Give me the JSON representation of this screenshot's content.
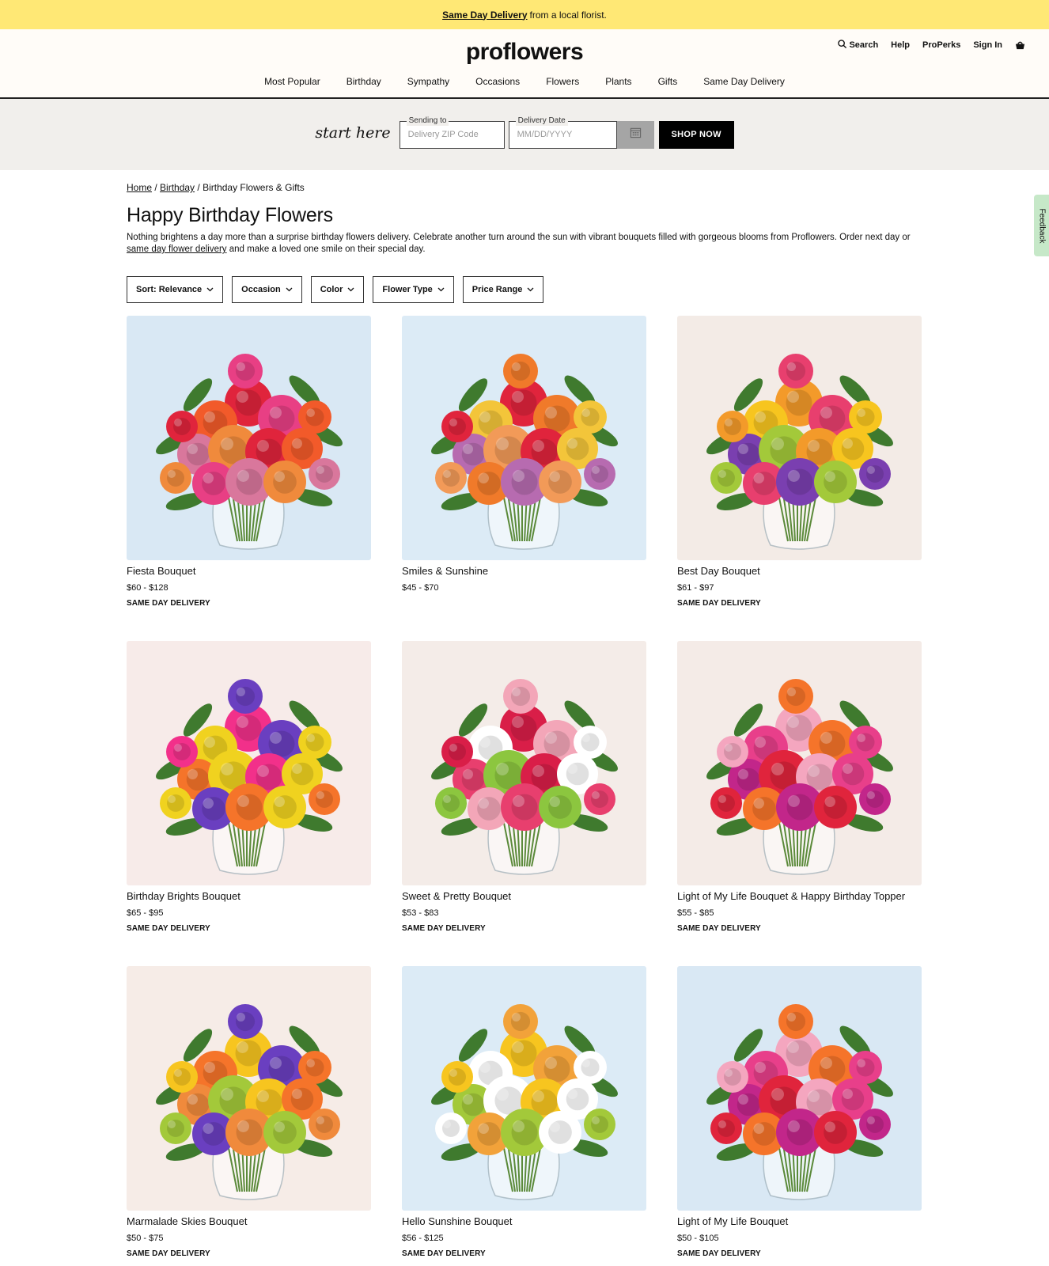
{
  "promo": {
    "link": "Same Day Delivery",
    "text": "from a local florist."
  },
  "header": {
    "logo": "proflowers",
    "utility": {
      "search": "Search",
      "help": "Help",
      "properks": "ProPerks",
      "signin": "Sign In"
    },
    "nav": [
      "Most Popular",
      "Birthday",
      "Sympathy",
      "Occasions",
      "Flowers",
      "Plants",
      "Gifts",
      "Same Day Delivery"
    ]
  },
  "start": {
    "label": "start here",
    "zip_legend": "Sending to",
    "zip_placeholder": "Delivery ZIP Code",
    "date_legend": "Delivery Date",
    "date_placeholder": "MM/DD/YYYY",
    "shop_button": "SHOP NOW"
  },
  "breadcrumb": {
    "home": "Home",
    "birthday": "Birthday",
    "current": "Birthday Flowers & Gifts"
  },
  "page": {
    "title": "Happy Birthday Flowers",
    "desc_before": "Nothing brightens a day more than a surprise birthday flowers delivery. Celebrate another turn around the sun with vibrant bouquets filled with gorgeous blooms from Proflowers. Order next day or",
    "desc_link": "same day flower delivery",
    "desc_after": "and make a loved one smile on their special day."
  },
  "filters": [
    "Sort: Relevance",
    "Occasion",
    "Color",
    "Flower Type",
    "Price Range"
  ],
  "products": [
    {
      "name": "Fiesta Bouquet",
      "price": "$60 - $128",
      "badge": "SAME DAY DELIVERY",
      "bg": "#d9e8f4",
      "colors": [
        "#e0243c",
        "#f25a2a",
        "#e83f84",
        "#d9779c",
        "#f08a3c"
      ]
    },
    {
      "name": "Smiles & Sunshine",
      "price": "$45 - $70",
      "badge": "",
      "bg": "#dcebf6",
      "colors": [
        "#e0243c",
        "#f3c53a",
        "#f07a2a",
        "#b76bb0",
        "#f29a58"
      ]
    },
    {
      "name": "Best Day Bouquet",
      "price": "$61 - $97",
      "badge": "SAME DAY DELIVERY",
      "bg": "#f3ebe6",
      "colors": [
        "#f39a2a",
        "#f7c51f",
        "#e83f6e",
        "#7a3fb0",
        "#a3c93a"
      ]
    },
    {
      "name": "Birthday Brights Bouquet",
      "price": "$65 - $95",
      "badge": "SAME DAY DELIVERY",
      "bg": "#f7ebe9",
      "colors": [
        "#f2308a",
        "#f0d21f",
        "#6a3fc0",
        "#f5742a",
        "#f0d21f"
      ]
    },
    {
      "name": "Sweet & Pretty Bouquet",
      "price": "$53 - $83",
      "badge": "SAME DAY DELIVERY",
      "bg": "#f4ece8",
      "colors": [
        "#d91e48",
        "#ffffff",
        "#f3a6b8",
        "#e83f6e",
        "#8cc63f"
      ]
    },
    {
      "name": "Light of My Life Bouquet & Happy Birthday Topper",
      "price": "$55 - $85",
      "badge": "SAME DAY DELIVERY",
      "bg": "#f4ebe7",
      "colors": [
        "#f4a6bf",
        "#e83f8a",
        "#f5742a",
        "#c2268a",
        "#e0243c"
      ]
    },
    {
      "name": "Marmalade Skies Bouquet",
      "price": "$50 - $75",
      "badge": "SAME DAY DELIVERY",
      "bg": "#f6ece7",
      "colors": [
        "#f7c51f",
        "#f5742a",
        "#6a3fc0",
        "#f08a3c",
        "#a3c93a"
      ]
    },
    {
      "name": "Hello Sunshine Bouquet",
      "price": "$56 - $125",
      "badge": "SAME DAY DELIVERY",
      "bg": "#dcebf6",
      "colors": [
        "#f7c51f",
        "#ffffff",
        "#f2a23a",
        "#a3c93a",
        "#ffffff"
      ]
    },
    {
      "name": "Light of My Life Bouquet",
      "price": "$50 - $105",
      "badge": "SAME DAY DELIVERY",
      "bg": "#d9e8f4",
      "colors": [
        "#f4a6bf",
        "#e83f8a",
        "#f5742a",
        "#c2268a",
        "#e0243c"
      ]
    }
  ],
  "feedback": "Feedback",
  "colors": {
    "promo_bg": "#ffe875",
    "header_bg": "#fffcf8",
    "start_bg": "#f1efec",
    "feedback_bg": "#c6e8c8"
  }
}
